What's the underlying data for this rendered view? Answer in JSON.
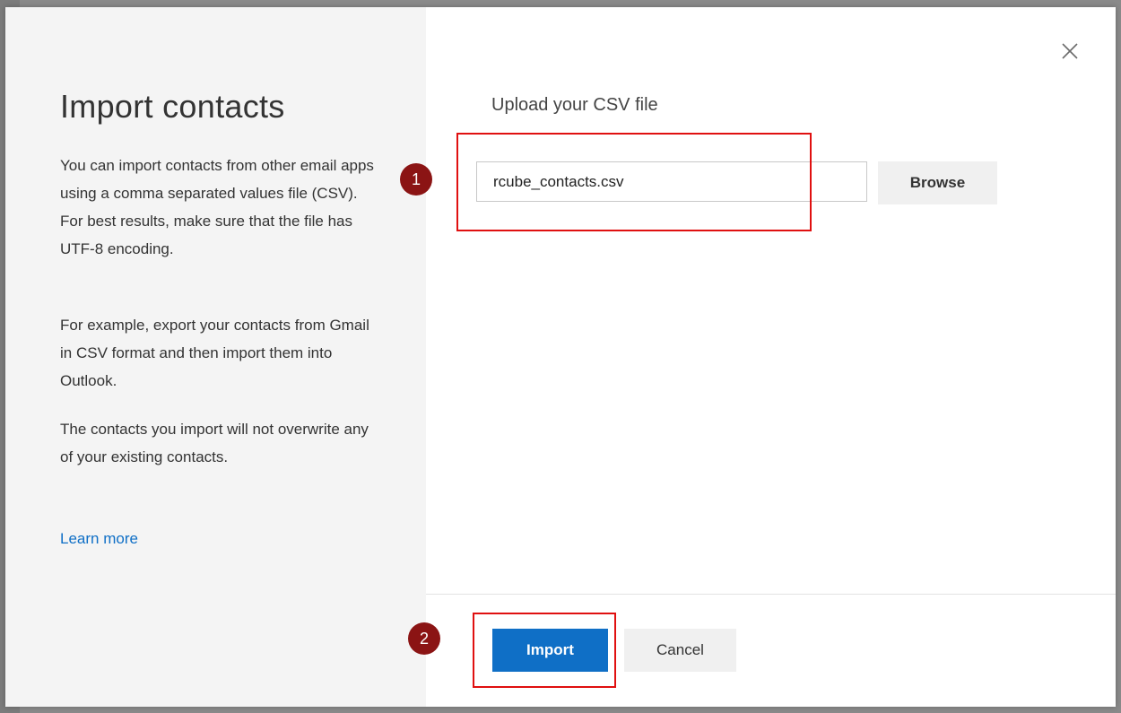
{
  "dialog": {
    "title": "Import contacts",
    "description": [
      "You can import contacts from other email apps using a comma separated values file (CSV). For best results, make sure that the file has UTF-8 encoding.",
      "For example, export your contacts from Gmail in CSV format and then import them into Outlook.",
      "The contacts you import will not overwrite any of your existing contacts."
    ],
    "learn_more": "Learn more",
    "upload_label": "Upload your CSV file",
    "file_input_value": "rcube_contacts.csv",
    "browse_label": "Browse",
    "import_label": "Import",
    "cancel_label": "Cancel",
    "close_icon": "close-icon"
  },
  "annotations": {
    "step1": "1",
    "step2": "2"
  },
  "backdrop": {
    "glyph": "C"
  },
  "colors": {
    "accent": "#0f6fc6",
    "highlight": "#e01010",
    "badge": "#8b1414",
    "left_pane_bg": "#f4f4f4"
  }
}
